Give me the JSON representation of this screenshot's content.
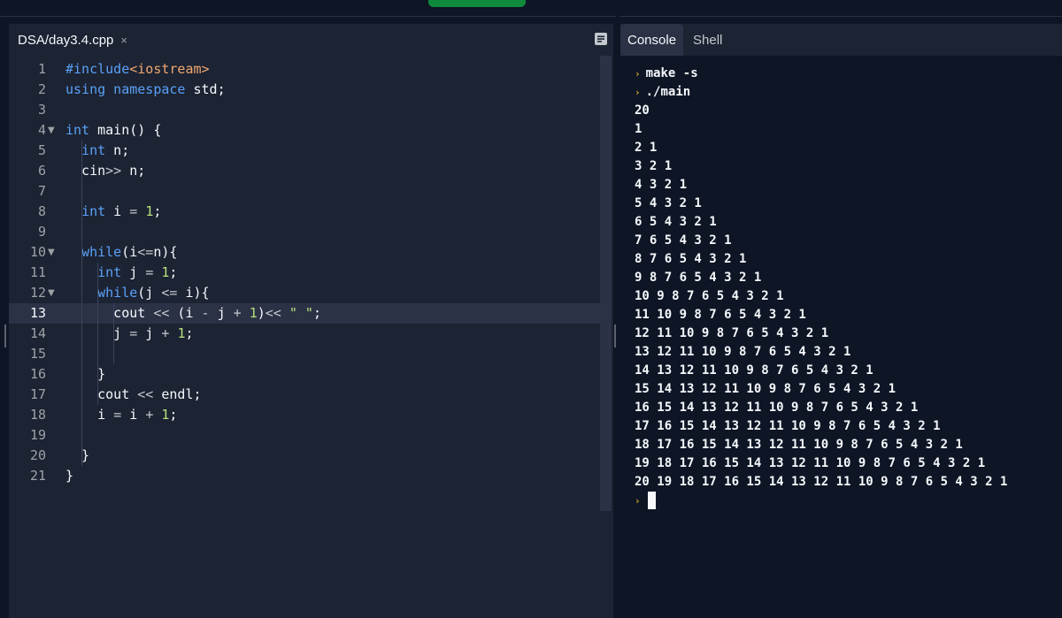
{
  "editor": {
    "tab_label": "DSA/day3.4.cpp",
    "tab_close": "×",
    "lines": [
      {
        "n": "1",
        "segments": [
          {
            "t": "#include",
            "c": "pp"
          },
          {
            "t": "<iostream>",
            "c": "inc"
          }
        ]
      },
      {
        "n": "2",
        "segments": [
          {
            "t": "using namespace",
            "c": "kw"
          },
          {
            "t": " std;",
            "c": ""
          }
        ]
      },
      {
        "n": "3",
        "segments": []
      },
      {
        "n": "4",
        "fold": true,
        "segments": [
          {
            "t": "int",
            "c": "kw"
          },
          {
            "t": " main() {",
            "c": ""
          }
        ]
      },
      {
        "n": "5",
        "segments": [
          {
            "t": "  ",
            "c": ""
          },
          {
            "t": "int",
            "c": "kw"
          },
          {
            "t": " n;",
            "c": ""
          }
        ]
      },
      {
        "n": "6",
        "segments": [
          {
            "t": "  cin",
            "c": ""
          },
          {
            "t": ">>",
            "c": "op"
          },
          {
            "t": " n;",
            "c": ""
          }
        ]
      },
      {
        "n": "7",
        "segments": []
      },
      {
        "n": "8",
        "segments": [
          {
            "t": "  ",
            "c": ""
          },
          {
            "t": "int",
            "c": "kw"
          },
          {
            "t": " i ",
            "c": ""
          },
          {
            "t": "=",
            "c": "op"
          },
          {
            "t": " ",
            "c": ""
          },
          {
            "t": "1",
            "c": "num"
          },
          {
            "t": ";",
            "c": ""
          }
        ]
      },
      {
        "n": "9",
        "segments": []
      },
      {
        "n": "10",
        "fold": true,
        "segments": [
          {
            "t": "  ",
            "c": ""
          },
          {
            "t": "while",
            "c": "kw"
          },
          {
            "t": "(i",
            "c": ""
          },
          {
            "t": "<=",
            "c": "op"
          },
          {
            "t": "n){",
            "c": ""
          }
        ]
      },
      {
        "n": "11",
        "segments": [
          {
            "t": "    ",
            "c": ""
          },
          {
            "t": "int",
            "c": "kw"
          },
          {
            "t": " j ",
            "c": ""
          },
          {
            "t": "=",
            "c": "op"
          },
          {
            "t": " ",
            "c": ""
          },
          {
            "t": "1",
            "c": "num"
          },
          {
            "t": ";",
            "c": ""
          }
        ]
      },
      {
        "n": "12",
        "fold": true,
        "segments": [
          {
            "t": "    ",
            "c": ""
          },
          {
            "t": "while",
            "c": "kw"
          },
          {
            "t": "(j ",
            "c": ""
          },
          {
            "t": "<=",
            "c": "op"
          },
          {
            "t": " i){",
            "c": ""
          }
        ]
      },
      {
        "n": "13",
        "active": true,
        "segments": [
          {
            "t": "      cout ",
            "c": ""
          },
          {
            "t": "<<",
            "c": "op"
          },
          {
            "t": " (i ",
            "c": ""
          },
          {
            "t": "-",
            "c": "op"
          },
          {
            "t": " j ",
            "c": ""
          },
          {
            "t": "+",
            "c": "op"
          },
          {
            "t": " ",
            "c": ""
          },
          {
            "t": "1",
            "c": "num"
          },
          {
            "t": ")",
            "c": ""
          },
          {
            "t": "<<",
            "c": "op"
          },
          {
            "t": " ",
            "c": ""
          },
          {
            "t": "\" \"",
            "c": "str"
          },
          {
            "t": ";",
            "c": ""
          }
        ]
      },
      {
        "n": "14",
        "segments": [
          {
            "t": "      j ",
            "c": ""
          },
          {
            "t": "=",
            "c": "op"
          },
          {
            "t": " j ",
            "c": ""
          },
          {
            "t": "+",
            "c": "op"
          },
          {
            "t": " ",
            "c": ""
          },
          {
            "t": "1",
            "c": "num"
          },
          {
            "t": ";",
            "c": ""
          }
        ]
      },
      {
        "n": "15",
        "segments": []
      },
      {
        "n": "16",
        "segments": [
          {
            "t": "    }",
            "c": ""
          }
        ]
      },
      {
        "n": "17",
        "segments": [
          {
            "t": "    cout ",
            "c": ""
          },
          {
            "t": "<<",
            "c": "op"
          },
          {
            "t": " endl;",
            "c": ""
          }
        ]
      },
      {
        "n": "18",
        "segments": [
          {
            "t": "    i ",
            "c": ""
          },
          {
            "t": "=",
            "c": "op"
          },
          {
            "t": " i ",
            "c": ""
          },
          {
            "t": "+",
            "c": "op"
          },
          {
            "t": " ",
            "c": ""
          },
          {
            "t": "1",
            "c": "num"
          },
          {
            "t": ";",
            "c": ""
          }
        ]
      },
      {
        "n": "19",
        "segments": []
      },
      {
        "n": "20",
        "segments": [
          {
            "t": "  }",
            "c": ""
          }
        ]
      },
      {
        "n": "21",
        "segments": [
          {
            "t": "}",
            "c": ""
          }
        ]
      }
    ]
  },
  "console": {
    "tabs": [
      "Console",
      "Shell"
    ],
    "prompt_glyph": "›",
    "commands": [
      "make -s",
      "./main"
    ],
    "output": [
      "20",
      "1",
      "2 1",
      "3 2 1",
      "4 3 2 1",
      "5 4 3 2 1",
      "6 5 4 3 2 1",
      "7 6 5 4 3 2 1",
      "8 7 6 5 4 3 2 1",
      "9 8 7 6 5 4 3 2 1",
      "10 9 8 7 6 5 4 3 2 1",
      "11 10 9 8 7 6 5 4 3 2 1",
      "12 11 10 9 8 7 6 5 4 3 2 1",
      "13 12 11 10 9 8 7 6 5 4 3 2 1",
      "14 13 12 11 10 9 8 7 6 5 4 3 2 1",
      "15 14 13 12 11 10 9 8 7 6 5 4 3 2 1",
      "16 15 14 13 12 11 10 9 8 7 6 5 4 3 2 1",
      "17 16 15 14 13 12 11 10 9 8 7 6 5 4 3 2 1",
      "18 17 16 15 14 13 12 11 10 9 8 7 6 5 4 3 2 1",
      "19 18 17 16 15 14 13 12 11 10 9 8 7 6 5 4 3 2 1",
      "20 19 18 17 16 15 14 13 12 11 10 9 8 7 6 5 4 3 2 1"
    ]
  },
  "colors": {
    "background": "#0e1525",
    "panel": "#1c2333",
    "keyword": "#5aa1f7",
    "number": "#b8e27e",
    "include": "#f0a870",
    "prompt": "#d4a82a",
    "run_button": "#0f8a3c"
  },
  "icons": [
    "outline-icon",
    "close-icon",
    "fold-arrow-icon",
    "prompt-chevron-icon"
  ]
}
